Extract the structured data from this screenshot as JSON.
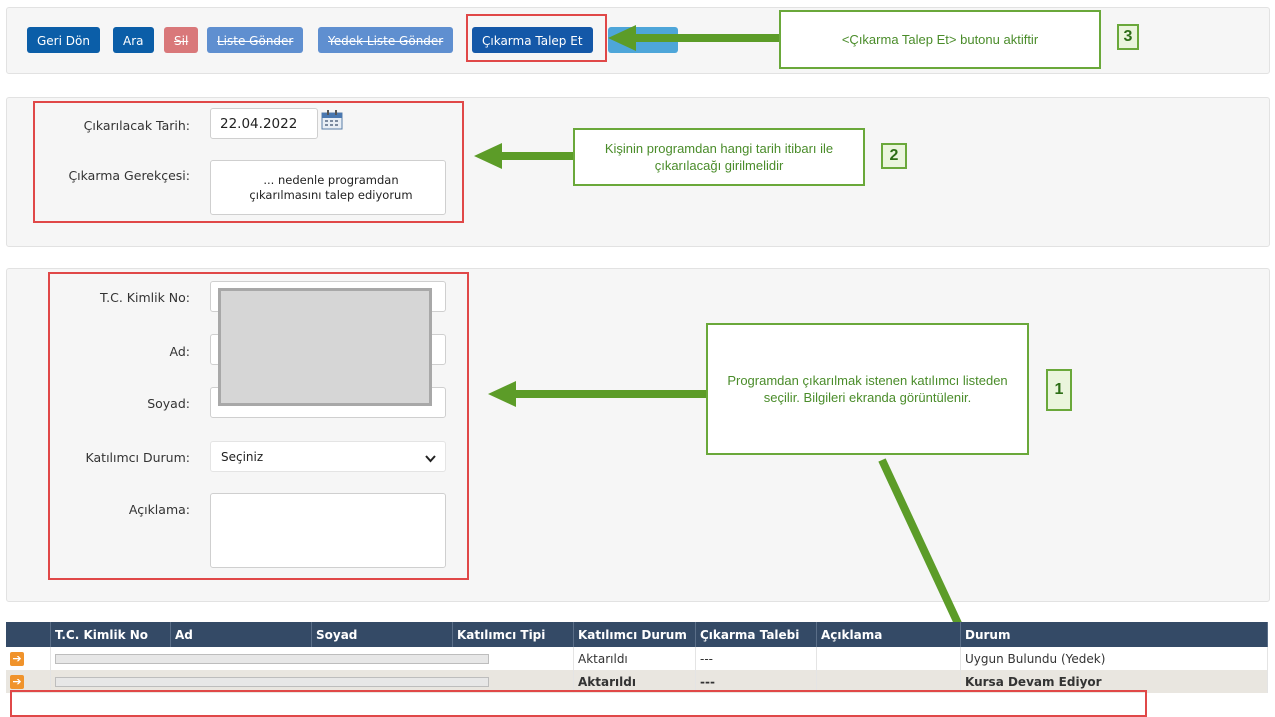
{
  "toolbar": {
    "back": "Geri Dön",
    "search": "Ara",
    "delete": "Sil",
    "send_list": "Liste Gönder",
    "send_backup_list": "Yedek Liste Gönder",
    "request_removal": "Çıkarma Talep Et"
  },
  "removal_form": {
    "date_label": "Çıkarılacak Tarih:",
    "date_value": "22.04.2022",
    "reason_label": "Çıkarma Gerekçesi:",
    "reason_value": "... nedenle programdan çıkarılmasını talep ediyorum"
  },
  "participant_form": {
    "tc_label": "T.C. Kimlik No:",
    "name_label": "Ad:",
    "surname_label": "Soyad:",
    "status_label": "Katılımcı Durum:",
    "status_value": "Seçiniz",
    "note_label": "Açıklama:"
  },
  "callouts": {
    "c3": "<Çıkarma Talep Et> butonu aktiftir",
    "c2": "Kişinin programdan hangi tarih itibarı ile çıkarılacağı girilmelidir",
    "c1": "Programdan çıkarılmak istenen katılımcı listeden seçilir. Bilgileri ekranda görüntülenir.",
    "n1": "1",
    "n2": "2",
    "n3": "3"
  },
  "table": {
    "columns": [
      "",
      "T.C. Kimlik No",
      "Ad",
      "Soyad",
      "Katılımcı Tipi",
      "Katılımcı Durum",
      "Çıkarma Talebi",
      "Açıklama",
      "Durum"
    ],
    "rows": [
      {
        "status": "Aktarıldı",
        "removal": "---",
        "note": "",
        "state": "Uygun Bulundu (Yedek)"
      },
      {
        "status": "Aktarıldı",
        "removal": "---",
        "note": "",
        "state": "Kursa Devam Ediyor"
      }
    ]
  },
  "colors": {
    "accent_green": "#5c9c28",
    "highlight_red": "#e04848",
    "table_header": "#344a66"
  },
  "icons": {
    "calendar": "calendar-icon",
    "row_action": "arrow-right-icon",
    "dropdown": "chevron-down-icon"
  }
}
